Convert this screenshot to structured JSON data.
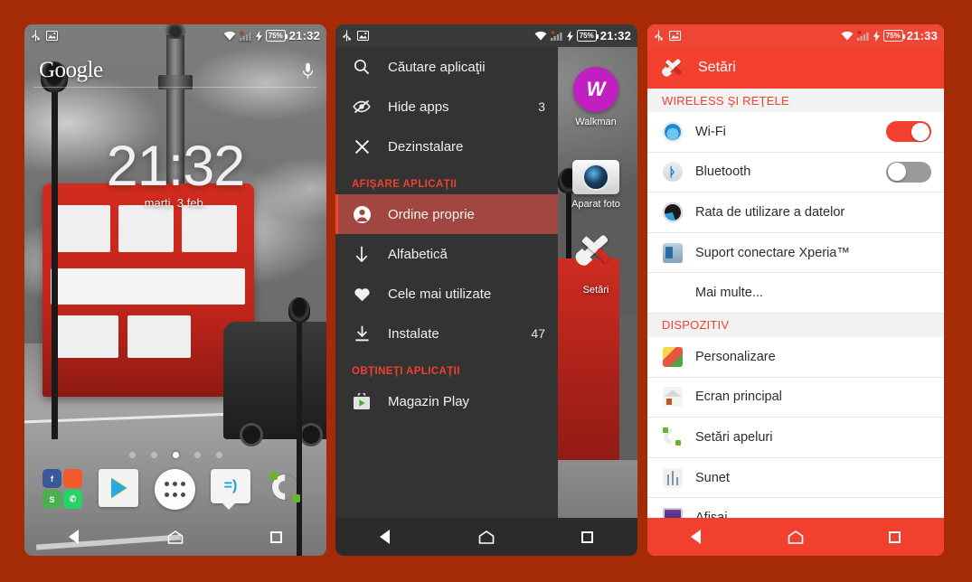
{
  "background_color": "#a52b06",
  "accent_red": "#f4402f",
  "phones": {
    "home": {
      "status_bar": {
        "left_icons": [
          "usb-icon",
          "screenshot-image-icon"
        ],
        "right_icons": [
          "wifi-icon",
          "cellular-signal-error-icon",
          "charging-bolt-icon"
        ],
        "battery_percent": "75%",
        "time": "21:32"
      },
      "search_widget": {
        "logo": "Google",
        "mic_icon": "microphone-icon"
      },
      "clock_widget": {
        "time": "21:32",
        "date": "marți, 3 feb."
      },
      "page_dots": {
        "count": 5,
        "active_index": 2
      },
      "dock": [
        {
          "name": "folder",
          "label": "",
          "apps": [
            "f",
            "a",
            "S",
            "w"
          ]
        },
        {
          "name": "play-store",
          "label": ""
        },
        {
          "name": "app-drawer",
          "label": ""
        },
        {
          "name": "messaging",
          "label": "=)"
        },
        {
          "name": "phone",
          "label": ""
        }
      ],
      "nav_bar": [
        "back-icon",
        "home-icon",
        "recents-icon"
      ]
    },
    "drawer": {
      "status_bar": {
        "left_icons": [
          "usb-icon",
          "screenshot-image-icon"
        ],
        "right_icons": [
          "wifi-icon",
          "cellular-signal-error-icon",
          "charging-bolt-icon"
        ],
        "battery_percent": "75%",
        "time": "21:32"
      },
      "menu": {
        "top_items": [
          {
            "icon": "search-icon",
            "label": "Căutare aplicaţii",
            "count": ""
          },
          {
            "icon": "hide-apps-icon",
            "label": "Hide apps",
            "count": "3"
          },
          {
            "icon": "close-x-icon",
            "label": "Dezinstalare",
            "count": ""
          }
        ],
        "section_1_title": "AFIŞARE APLICAŢII",
        "section_1_items": [
          {
            "icon": "person-icon",
            "label": "Ordine proprie",
            "count": "",
            "selected": true
          },
          {
            "icon": "arrow-down-icon",
            "label": "Alfabetică",
            "count": "",
            "selected": false
          },
          {
            "icon": "heart-icon",
            "label": "Cele mai utilizate",
            "count": "",
            "selected": false
          },
          {
            "icon": "download-icon",
            "label": "Instalate",
            "count": "47",
            "selected": false
          }
        ],
        "section_2_title": "OBŢINEŢI APLICAŢII",
        "section_2_items": [
          {
            "icon": "play-store-icon",
            "label": "Magazin Play",
            "count": "",
            "selected": false
          }
        ]
      },
      "apps": [
        {
          "icon": "walkman-icon",
          "label": "Walkman"
        },
        {
          "icon": "camera-icon",
          "label": "Aparat foto"
        },
        {
          "icon": "settings-wrench-icon",
          "label": "Setări"
        }
      ],
      "nav_bar": [
        "back-icon",
        "home-icon",
        "recents-icon"
      ]
    },
    "settings": {
      "status_bar": {
        "left_icons": [
          "usb-icon",
          "screenshot-image-icon"
        ],
        "right_icons": [
          "wifi-icon",
          "cellular-signal-error-icon",
          "charging-bolt-icon"
        ],
        "battery_percent": "75%",
        "time": "21:33"
      },
      "app_bar": {
        "icon": "settings-wrench-icon",
        "title": "Setări"
      },
      "sections": [
        {
          "title": "WIRELESS ŞI REŢELE",
          "rows": [
            {
              "icon": "wifi-icon",
              "label": "Wi-Fi",
              "control": "switch",
              "state": "on"
            },
            {
              "icon": "bluetooth-icon",
              "label": "Bluetooth",
              "control": "switch",
              "state": "off"
            },
            {
              "icon": "data-usage-icon",
              "label": "Rata de utilizare a datelor",
              "control": "none",
              "state": ""
            },
            {
              "icon": "xperia-connect-icon",
              "label": "Suport conectare Xperia™",
              "control": "none",
              "state": ""
            },
            {
              "icon": "none",
              "label": "Mai multe...",
              "control": "none",
              "state": ""
            }
          ]
        },
        {
          "title": "DISPOZITIV",
          "rows": [
            {
              "icon": "personalization-icon",
              "label": "Personalizare",
              "control": "none",
              "state": ""
            },
            {
              "icon": "home-screen-icon",
              "label": "Ecran principal",
              "control": "none",
              "state": ""
            },
            {
              "icon": "call-settings-icon",
              "label": "Setări apeluri",
              "control": "none",
              "state": ""
            },
            {
              "icon": "sound-icon",
              "label": "Sunet",
              "control": "none",
              "state": ""
            },
            {
              "icon": "display-icon",
              "label": "Afişaj",
              "control": "none",
              "state": ""
            }
          ]
        }
      ],
      "nav_bar": [
        "back-icon",
        "home-icon",
        "recents-icon"
      ]
    }
  }
}
